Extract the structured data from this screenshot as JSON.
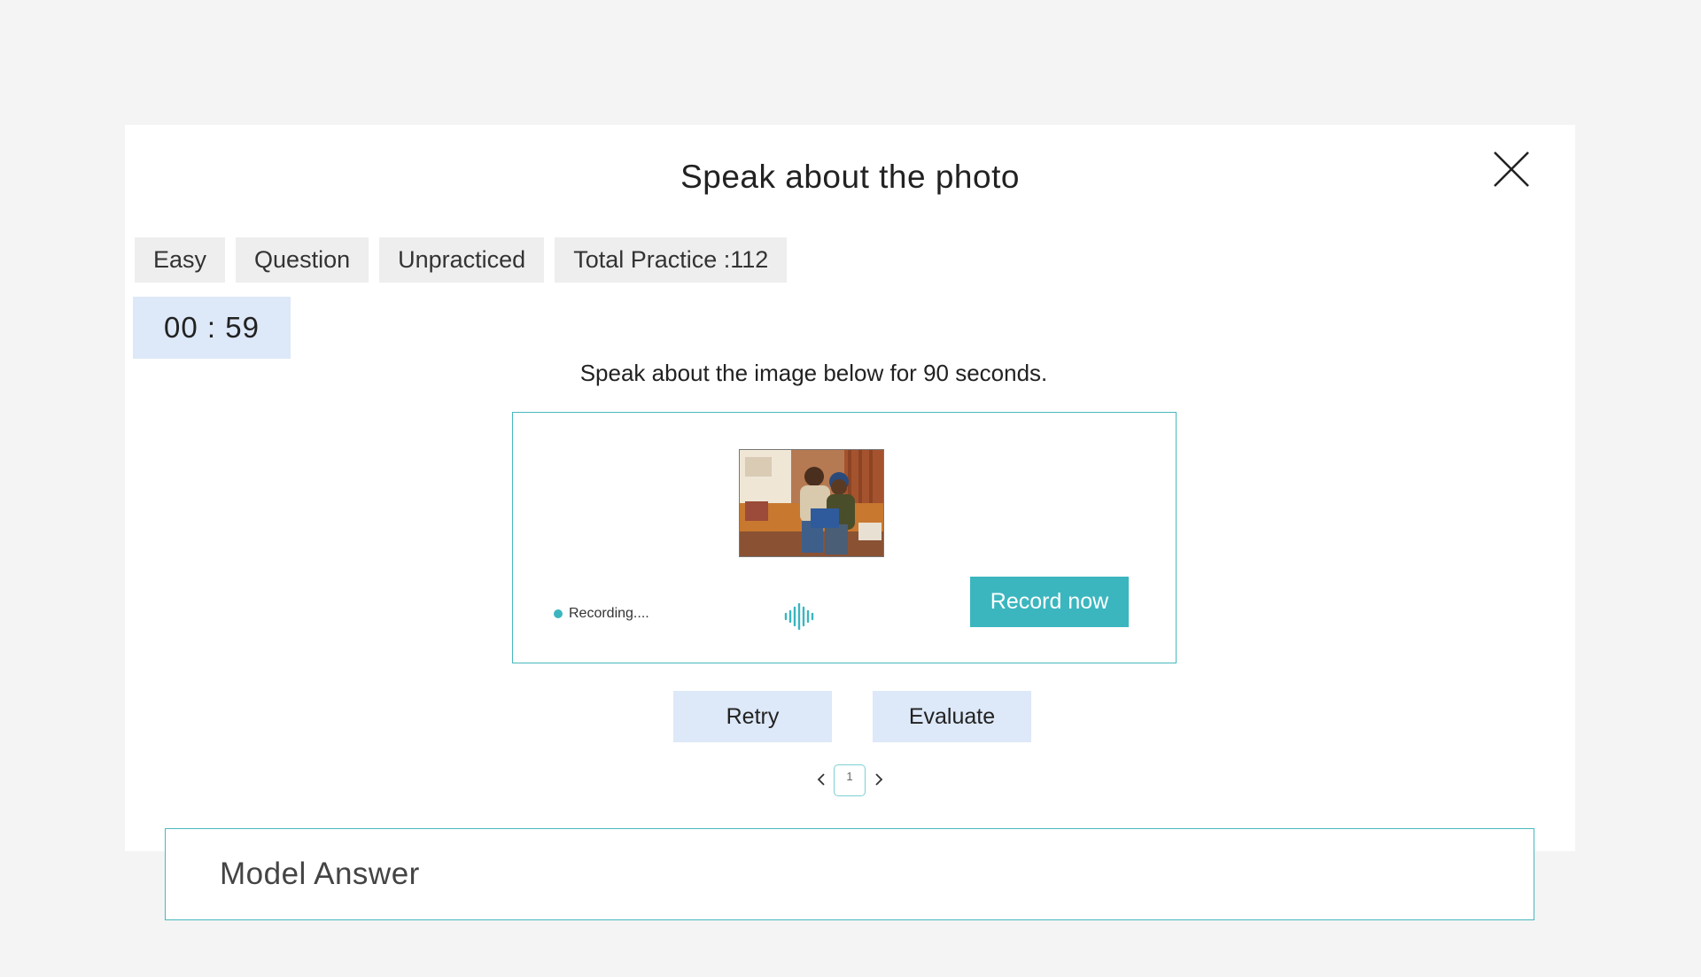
{
  "modal": {
    "title": "Speak about the photo",
    "close_icon": "close-icon"
  },
  "tags": [
    {
      "label": "Easy"
    },
    {
      "label": "Question"
    },
    {
      "label": "Unpracticed"
    },
    {
      "label": "Total Practice :112"
    }
  ],
  "timer": {
    "value": "00 : 59"
  },
  "instruction": "Speak about the image below for 90 seconds.",
  "recorder": {
    "photo_icon": "photo-image",
    "status_text": "Recording....",
    "wave_icon": "audio-wave-icon",
    "record_label": "Record now"
  },
  "actions": {
    "retry_label": "Retry",
    "evaluate_label": "Evaluate"
  },
  "pagination": {
    "current_page": "1",
    "prev_icon": "chevron-left-icon",
    "next_icon": "chevron-right-icon"
  },
  "model_answer": {
    "label": "Model Answer"
  },
  "colors": {
    "accent": "#3bb6bf",
    "light_blue": "#dde8f8",
    "tag_bg": "#eeeeee",
    "page_bg": "#f4f4f4"
  }
}
